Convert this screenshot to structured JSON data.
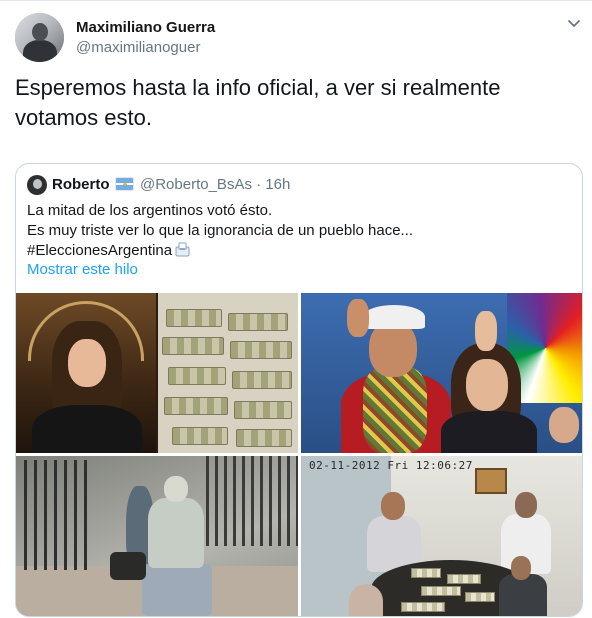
{
  "tweet": {
    "author": {
      "name": "Maximiliano Guerra",
      "handle": "@maximilianoguer"
    },
    "text": "Esperemos hasta la info oficial, a ver si realmente\nvotamos esto.",
    "icons": {
      "menu": "chevron-down-icon",
      "avatar": "avatar"
    }
  },
  "quoted": {
    "author": {
      "name": "Roberto",
      "flag": "flag-argentina-icon",
      "handle": "@Roberto_BsAs · 16h"
    },
    "lines": [
      "La mitad de los argentinos votó ésto.",
      "Es muy triste ver lo que la ignorancia de un pueblo hace...",
      "#EleccionesArgentina"
    ],
    "ballot_icon": "ballot-box-icon",
    "show_thread": "Mostrar este hilo",
    "media": {
      "count": 4,
      "timestamp": "02-11-2012 Fri 12:06:27"
    }
  },
  "colors": {
    "link": "#1da1f2",
    "secondary_text": "#657786",
    "border": "#ccd6dd"
  }
}
